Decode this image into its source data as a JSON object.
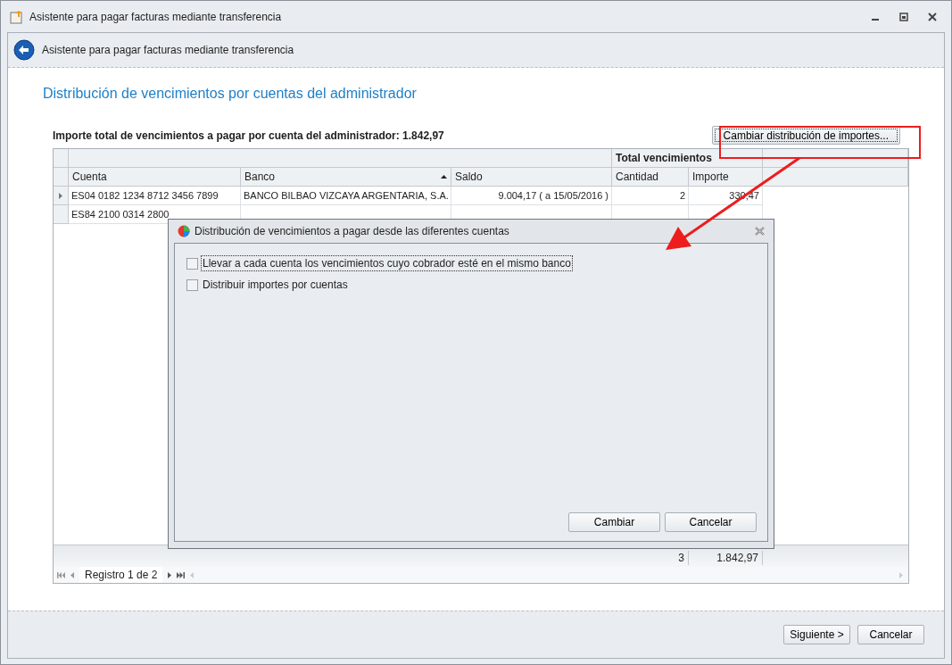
{
  "window": {
    "title": "Asistente para pagar facturas mediante transferencia"
  },
  "header": {
    "title": "Asistente para pagar facturas mediante transferencia"
  },
  "page_title": "Distribución de vencimientos por cuentas del administrador",
  "summary": "Importe total de vencimientos a pagar por cuenta del administrador: 1.842,97",
  "change_button": "Cambiar distribución de importes...",
  "table": {
    "band": "Total vencimientos",
    "columns": [
      {
        "label": "Cuenta",
        "sorted": false
      },
      {
        "label": "Banco",
        "sorted": true
      },
      {
        "label": "Saldo",
        "sorted": false
      },
      {
        "label": "Cantidad",
        "sorted": false
      },
      {
        "label": "Importe",
        "sorted": false
      }
    ],
    "rows": [
      {
        "selected": true,
        "cells": [
          "ES04 0182 1234 8712 3456 7899",
          "BANCO BILBAO VIZCAYA ARGENTARIA, S.A.",
          "9.004,17 ( a 15/05/2016 )",
          "2",
          "330,47"
        ]
      },
      {
        "selected": false,
        "cells": [
          "ES84 2100 0314 2800"
        ]
      }
    ],
    "totals": [
      "3",
      "1.842,97"
    ],
    "navigator": "Registro 1 de 2"
  },
  "dialog": {
    "title": "Distribución de vencimientos a pagar desde las diferentes cuentas",
    "options": [
      {
        "label": "Llevar a cada cuenta los vencimientos cuyo cobrador esté en el mismo banco",
        "checked": false,
        "focused": true
      },
      {
        "label": "Distribuir importes por cuentas",
        "checked": false,
        "focused": false
      }
    ],
    "buttons": [
      "Cambiar",
      "Cancelar"
    ]
  },
  "buttons": [
    "Siguiente >",
    "Cancelar"
  ]
}
